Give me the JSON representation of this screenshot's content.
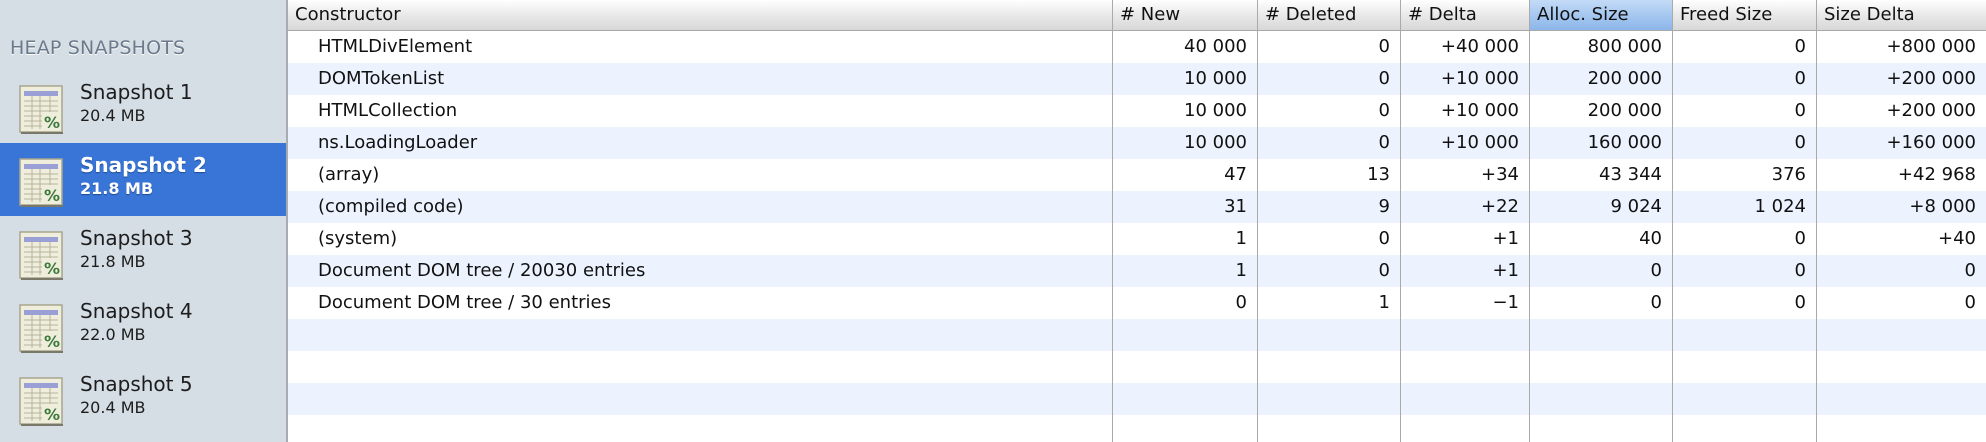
{
  "sidebar": {
    "heading": "HEAP SNAPSHOTS",
    "selected_index": 1,
    "items": [
      {
        "title": "Snapshot 1",
        "size": "20.4 MB",
        "icon": "heap-snapshot-icon"
      },
      {
        "title": "Snapshot 2",
        "size": "21.8 MB",
        "icon": "heap-snapshot-icon"
      },
      {
        "title": "Snapshot 3",
        "size": "21.8 MB",
        "icon": "heap-snapshot-icon"
      },
      {
        "title": "Snapshot 4",
        "size": "22.0 MB",
        "icon": "heap-snapshot-icon"
      },
      {
        "title": "Snapshot 5",
        "size": "20.4 MB",
        "icon": "heap-snapshot-icon"
      }
    ]
  },
  "table": {
    "sorted_column": 4,
    "columns": [
      "Constructor",
      "# New",
      "# Deleted",
      "# Delta",
      "Alloc. Size",
      "Freed Size",
      "Size Delta"
    ],
    "rows": [
      [
        "HTMLDivElement",
        "40 000",
        "0",
        "+40 000",
        "800 000",
        "0",
        "+800 000"
      ],
      [
        "DOMTokenList",
        "10 000",
        "0",
        "+10 000",
        "200 000",
        "0",
        "+200 000"
      ],
      [
        "HTMLCollection",
        "10 000",
        "0",
        "+10 000",
        "200 000",
        "0",
        "+200 000"
      ],
      [
        "ns.LoadingLoader",
        "10 000",
        "0",
        "+10 000",
        "160 000",
        "0",
        "+160 000"
      ],
      [
        "(array)",
        "47",
        "13",
        "+34",
        "43 344",
        "376",
        "+42 968"
      ],
      [
        "(compiled code)",
        "31",
        "9",
        "+22",
        "9 024",
        "1 024",
        "+8 000"
      ],
      [
        "(system)",
        "1",
        "0",
        "+1",
        "40",
        "0",
        "+40"
      ],
      [
        "Document DOM tree / 20030 entries",
        "1",
        "0",
        "+1",
        "0",
        "0",
        "0"
      ],
      [
        "Document DOM tree / 30 entries",
        "0",
        "1",
        "−1",
        "0",
        "0",
        "0"
      ]
    ]
  },
  "colors": {
    "selection": "#3875d7",
    "stripe": "#edf3fe",
    "sidebar": "#d5dde5",
    "sorted_header": "#a6c8f0"
  }
}
